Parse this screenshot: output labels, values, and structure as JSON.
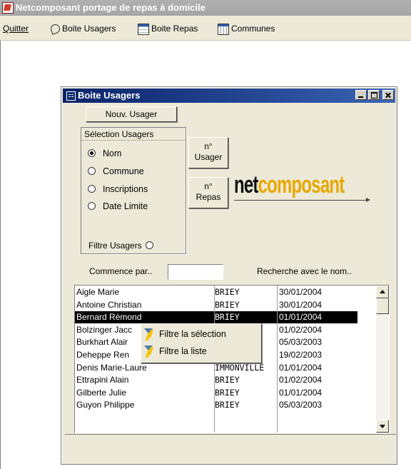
{
  "app": {
    "title": "Netcomposant portage de repas à domicile"
  },
  "menu": {
    "quit": "Quitter",
    "items": [
      {
        "label": "Boite Usagers",
        "icon": "pen-icon"
      },
      {
        "label": "Boite Repas",
        "icon": "form-icon"
      },
      {
        "label": "Communes",
        "icon": "list-icon"
      }
    ]
  },
  "window": {
    "title": "Boite Usagers",
    "new_button": "Nouv. Usager",
    "selection_group": {
      "title": "Sélection Usagers",
      "options": [
        "Nom",
        "Commune",
        "Inscriptions",
        "Date Limite"
      ],
      "selected": "Nom",
      "filter_label": "Filtre Usagers"
    },
    "n_usager_button": "n°\nUsager",
    "n_repas_button": "n°\nRepas",
    "logo": {
      "part1": "net",
      "part2": "composant"
    },
    "starts_with_label": "Commence par..",
    "starts_with_value": "",
    "search_label": "Recherche avec le nom..",
    "list": {
      "rows": [
        [
          "Aigle  Marie",
          "BRIEY",
          "30/01/2004"
        ],
        [
          "Antoine Christian",
          "BRIEY",
          "30/01/2004"
        ],
        [
          "Bernard Rémond",
          "BRIEY",
          "01/01/2004"
        ],
        [
          "Bolzinger Jacc",
          "ILL",
          "01/02/2004"
        ],
        [
          "Burkhart  Alair",
          "",
          "05/03/2003"
        ],
        [
          "Deheppe Ren",
          "E",
          "19/02/2003"
        ],
        [
          "Denis Marie-Laure",
          "IMMONVILLE",
          "01/01/2004"
        ],
        [
          "Ettrapini Alain",
          "BRIEY",
          "01/02/2004"
        ],
        [
          "Gilberte Julie",
          "BRIEY",
          "01/01/2004"
        ],
        [
          "Guyon Philippe",
          "BRIEY",
          "05/03/2003"
        ]
      ],
      "selected_index": 2
    },
    "context_menu": [
      "Filtre la sélection",
      "Filtre la liste"
    ]
  },
  "colors": {
    "title_active": "#0a246a",
    "face": "#ece9d8",
    "logo_accent": "#e8a800"
  }
}
